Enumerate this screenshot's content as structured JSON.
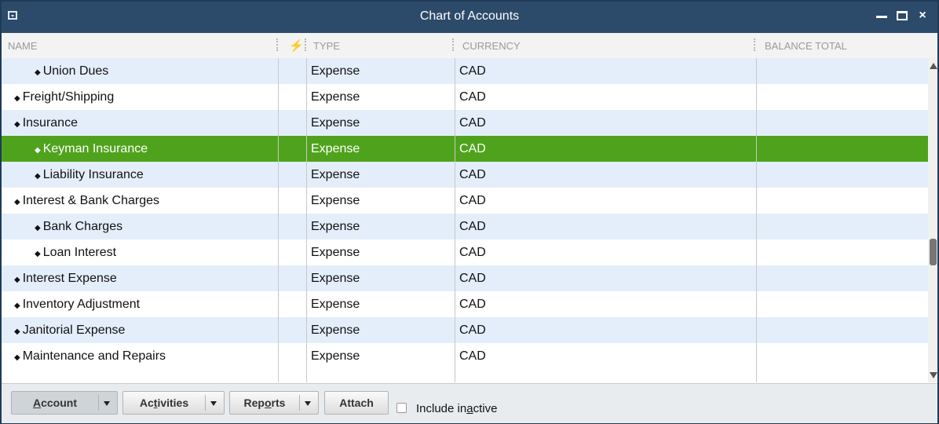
{
  "window": {
    "title": "Chart of Accounts",
    "close_glyph": "×"
  },
  "columns": {
    "name": "NAME",
    "type": "TYPE",
    "currency": "CURRENCY",
    "balance": "BALANCE TOTAL",
    "online_icon": "lightning-bolt-icon"
  },
  "rows": [
    {
      "name": "Union Dues",
      "level": 1,
      "type": "Expense",
      "currency": "CAD",
      "balance": ""
    },
    {
      "name": "Freight/Shipping",
      "level": 0,
      "type": "Expense",
      "currency": "CAD",
      "balance": ""
    },
    {
      "name": "Insurance",
      "level": 0,
      "type": "Expense",
      "currency": "CAD",
      "balance": ""
    },
    {
      "name": "Keyman Insurance",
      "level": 1,
      "type": "Expense",
      "currency": "CAD",
      "balance": "",
      "selected": true
    },
    {
      "name": "Liability Insurance",
      "level": 1,
      "type": "Expense",
      "currency": "CAD",
      "balance": ""
    },
    {
      "name": "Interest & Bank Charges",
      "level": 0,
      "type": "Expense",
      "currency": "CAD",
      "balance": ""
    },
    {
      "name": "Bank Charges",
      "level": 1,
      "type": "Expense",
      "currency": "CAD",
      "balance": ""
    },
    {
      "name": "Loan Interest",
      "level": 1,
      "type": "Expense",
      "currency": "CAD",
      "balance": ""
    },
    {
      "name": "Interest Expense",
      "level": 0,
      "type": "Expense",
      "currency": "CAD",
      "balance": ""
    },
    {
      "name": "Inventory Adjustment",
      "level": 0,
      "type": "Expense",
      "currency": "CAD",
      "balance": ""
    },
    {
      "name": "Janitorial Expense",
      "level": 0,
      "type": "Expense",
      "currency": "CAD",
      "balance": ""
    },
    {
      "name": "Maintenance and Repairs",
      "level": 0,
      "type": "Expense",
      "currency": "CAD",
      "balance": ""
    }
  ],
  "diamond_glyph": "◆",
  "toolbar": {
    "account": {
      "pre": "",
      "mnemonic": "A",
      "post": "ccount"
    },
    "activities": {
      "pre": "Ac",
      "mnemonic": "t",
      "post": "ivities"
    },
    "reports": {
      "pre": "Rep",
      "mnemonic": "o",
      "post": "rts"
    },
    "attach": "Attach",
    "include_inactive": {
      "pre": "Include in",
      "mnemonic": "a",
      "post": "ctive"
    }
  },
  "colors": {
    "titlebar": "#2c4a69",
    "selected_row": "#4fa31c",
    "alt_row": "#e4eefb"
  }
}
